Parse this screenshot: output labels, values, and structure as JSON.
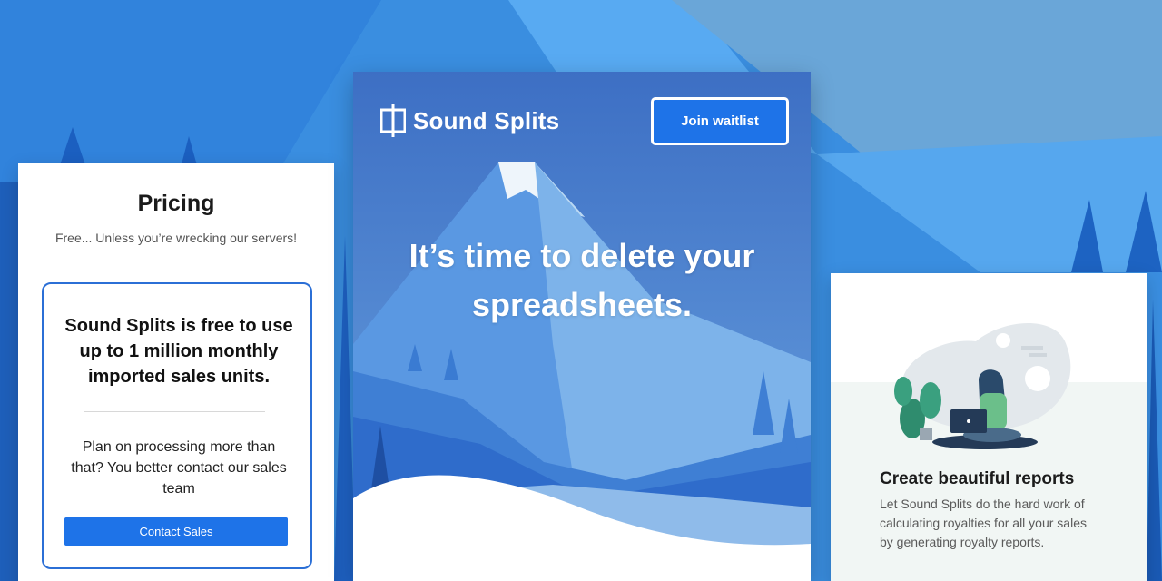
{
  "pricing": {
    "title": "Pricing",
    "subtitle": "Free... Unless you’re wrecking our servers!",
    "plan": {
      "headline": "Sound Splits is free to use up to 1 million monthly imported sales units.",
      "note": "Plan on processing more than that? You better contact our sales team",
      "button_label": "Contact Sales"
    }
  },
  "hero": {
    "brand_name": "Sound Splits",
    "logo_icon": "bracket-logo-icon",
    "waitlist_label": "Join waitlist",
    "headline": "It’s time to delete your spreadsheets."
  },
  "reports": {
    "title": "Create beautiful reports",
    "body": "Let Sound Splits do the hard work of calculating royalties for all your sales by generating royalty reports.",
    "illustration_icon": "woman-with-laptop-illustration"
  },
  "colors": {
    "accent": "#1e73e8",
    "background": "#3d8fe0",
    "card": "#ffffff"
  }
}
